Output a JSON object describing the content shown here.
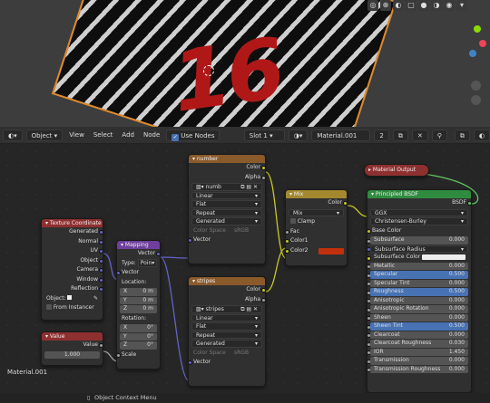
{
  "header": {
    "mode": "Object",
    "menus": [
      "View",
      "Select",
      "Add",
      "Node"
    ],
    "use_nodes": "Use Nodes",
    "slot": "Slot 1",
    "material": "Material.001",
    "users": "2"
  },
  "nodes": {
    "texcoord": {
      "title": "Texture Coordinate",
      "outputs": [
        "Generated",
        "Normal",
        "UV",
        "Object",
        "Camera",
        "Window",
        "Reflection"
      ],
      "object_label": "Object:",
      "from_instancer": "From Instancer"
    },
    "value": {
      "title": "Value",
      "output": "Value",
      "val": "1.000"
    },
    "mapping": {
      "title": "Mapping",
      "output": "Vector",
      "type_label": "Type:",
      "type_val": "Poin▾",
      "vector": "Vector",
      "location": "Location:",
      "loc": [
        [
          "X",
          "0 m"
        ],
        [
          "Y",
          "0 m"
        ],
        [
          "Z",
          "0 m"
        ]
      ],
      "rotation": "Rotation:",
      "rot": [
        [
          "X",
          "0°"
        ],
        [
          "Y",
          "0°"
        ],
        [
          "Z",
          "0°"
        ]
      ],
      "scale": "Scale"
    },
    "number": {
      "title": "number",
      "out_color": "Color",
      "out_alpha": "Alpha",
      "image": "numb",
      "interp": "Linear",
      "proj": "Flat",
      "ext": "Repeat",
      "source": "Generated",
      "colorspace_label": "Color Space",
      "colorspace": "sRGB",
      "vector": "Vector"
    },
    "stripes": {
      "title": "stripes",
      "out_color": "Color",
      "out_alpha": "Alpha",
      "image": "stripes",
      "interp": "Linear",
      "proj": "Flat",
      "ext": "Repeat",
      "source": "Generated",
      "colorspace_label": "Color Space",
      "colorspace": "sRGB",
      "vector": "Vector"
    },
    "mix": {
      "title": "Mix",
      "out": "Color",
      "blend": "Mix",
      "clamp": "Clamp",
      "fac": "Fac",
      "color1": "Color1",
      "color2": "Color2"
    },
    "output": {
      "title": "Material Output"
    },
    "bsdf": {
      "title": "Principled BSDF",
      "out": "BSDF",
      "distribution": "GGX",
      "sss_method": "Christensen-Burley",
      "base_color": "Base Color",
      "rows": [
        [
          "Subsurface",
          "0.000",
          ""
        ],
        [
          "Subsurface Radius",
          "",
          ""
        ],
        [
          "Subsurface Color",
          "",
          ""
        ],
        [
          "Metallic",
          "0.000",
          ""
        ],
        [
          "Specular",
          "0.500",
          "hl"
        ],
        [
          "Specular Tint",
          "0.000",
          ""
        ],
        [
          "Roughness",
          "0.500",
          "hl"
        ],
        [
          "Anisotropic",
          "0.000",
          ""
        ],
        [
          "Anisotropic Rotation",
          "0.000",
          ""
        ],
        [
          "Sheen",
          "0.000",
          ""
        ],
        [
          "Sheen Tint",
          "0.500",
          "hl"
        ],
        [
          "Clearcoat",
          "0.000",
          ""
        ],
        [
          "Clearcoat Roughness",
          "0.030",
          ""
        ],
        [
          "IOR",
          "1.450",
          ""
        ],
        [
          "Transmission",
          "0.000",
          ""
        ],
        [
          "Transmission Roughness",
          "0.000",
          ""
        ]
      ]
    }
  },
  "viewport": {
    "number_text": "16"
  },
  "footer": {
    "hint": "Object Context Menu"
  },
  "editor_label": "Material.001"
}
